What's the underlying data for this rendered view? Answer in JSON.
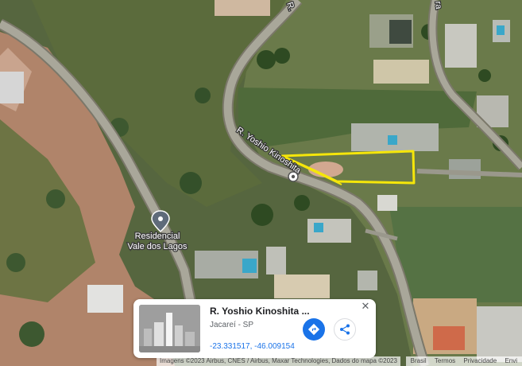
{
  "map": {
    "road_top_center": "R.",
    "road_top_right": "ra",
    "road_main": "R. Yoshio Kinoshita",
    "poi_line1": "Residencial",
    "poi_line2": "Vale dos Lagos",
    "highlight_color": "#f5e60a",
    "pin_icon": "place-pin-icon"
  },
  "card": {
    "title": "R. Yoshio Kinoshita ...",
    "subtitle": "Jacareí - SP",
    "coordinates": "-23.331517, -46.009154",
    "accent_color": "#1a73e8",
    "directions_icon": "directions-icon",
    "share_icon": "share-icon",
    "close_icon": "close-icon"
  },
  "footer": {
    "attribution": "Imagens ©2023 Airbus, CNES / Airbus, Maxar Technologies, Dados do mapa ©2023",
    "links": [
      "Brasil",
      "Termos",
      "Privacidade",
      "Envi"
    ]
  }
}
